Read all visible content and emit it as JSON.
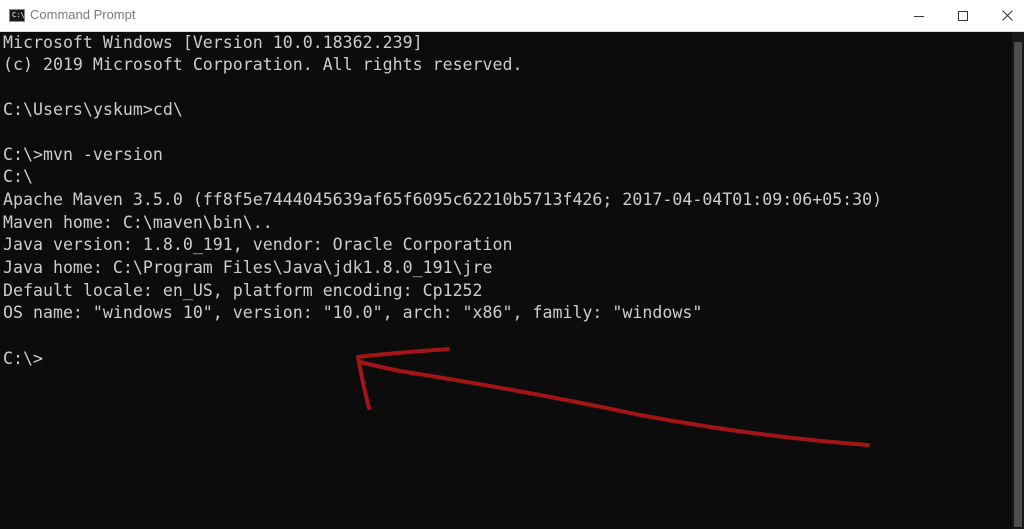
{
  "window": {
    "title": "Command Prompt",
    "app_icon": "cmd-prompt-icon",
    "app_icon_glyph": "C:\\",
    "controls": {
      "minimize": "minimize-icon",
      "maximize": "maximize-icon",
      "close": "close-icon"
    }
  },
  "console": {
    "lines": [
      "Microsoft Windows [Version 10.0.18362.239]",
      "(c) 2019 Microsoft Corporation. All rights reserved.",
      "",
      "C:\\Users\\yskum>cd\\",
      "",
      "C:\\>mvn -version",
      "C:\\",
      "Apache Maven 3.5.0 (ff8f5e7444045639af65f6095c62210b5713f426; 2017-04-04T01:09:06+05:30)",
      "Maven home: C:\\maven\\bin\\..",
      "Java version: 1.8.0_191, vendor: Oracle Corporation",
      "Java home: C:\\Program Files\\Java\\jdk1.8.0_191\\jre",
      "Default locale: en_US, platform encoding: Cp1252",
      "OS name: \"windows 10\", version: \"10.0\", arch: \"x86\", family: \"windows\"",
      "",
      "C:\\>"
    ]
  },
  "annotation": {
    "type": "hand-drawn-arrow",
    "color": "#a31515"
  },
  "colors": {
    "console_background": "#0c0c0c",
    "console_text": "#cccccc",
    "titlebar_background": "#ffffff",
    "title_text": "#7a7a7a"
  }
}
